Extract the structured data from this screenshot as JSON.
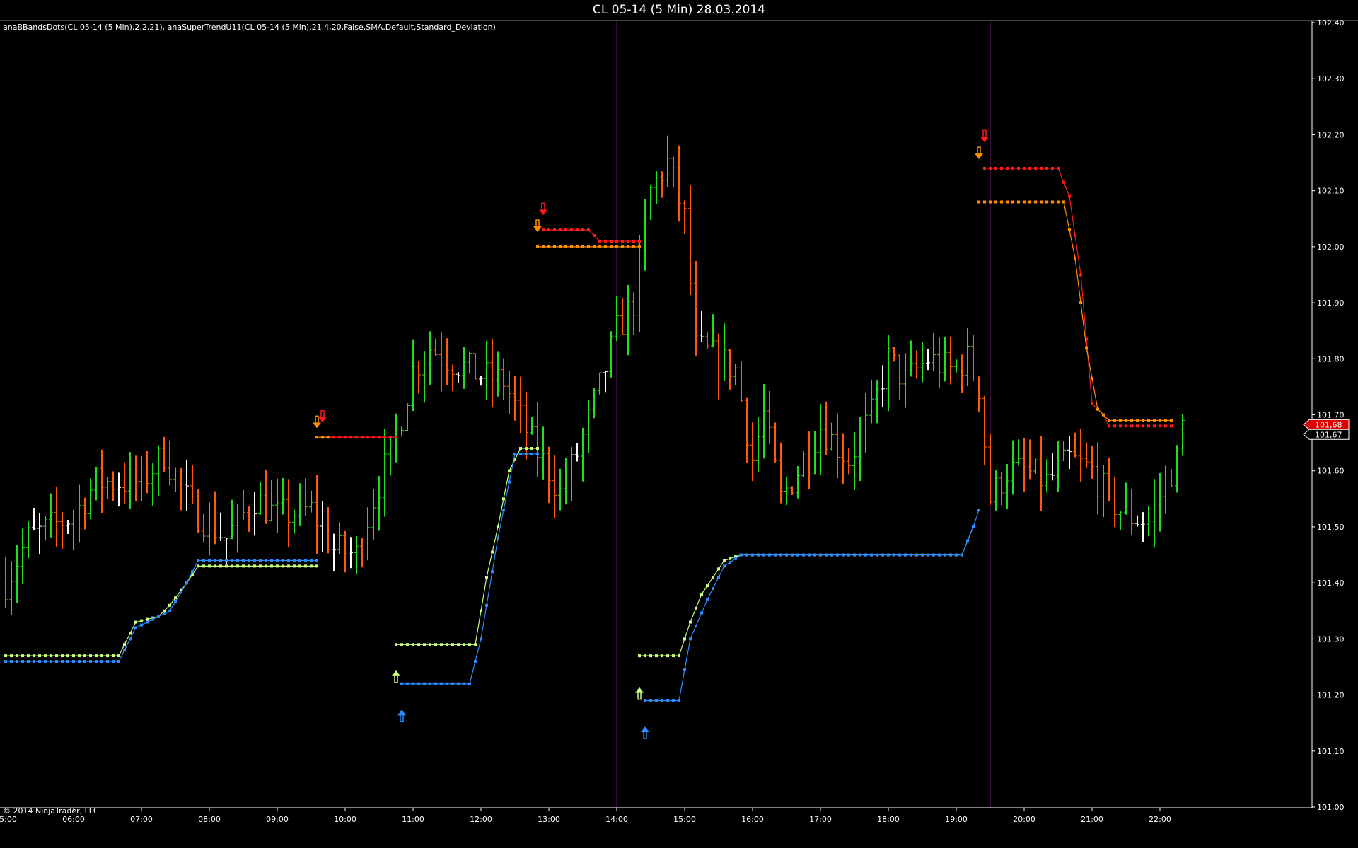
{
  "window": {
    "title": "CL 05-14 (5 Min)  28.03.2014"
  },
  "indicators_label": "anaBBandsDots(CL 05-14 (5 Min),2,2,21), anaSuperTrendU11(CL 05-14 (5 Min),21,4,20,False,SMA,Default,Standard_Deviation)",
  "copyright": "© 2014 NinjaTrader, LLC",
  "colors": {
    "background": "#000000",
    "up_bar": "#22dd22",
    "down_bar": "#ff5a0a",
    "neutral_bar": "#ffffff",
    "st_red": "#ff1a1a",
    "st_orange": "#ff8c00",
    "st_blue": "#2b8cff",
    "st_lightgreen": "#c8ff80",
    "session_line": "#6a1a6a",
    "axis": "#ffffff",
    "price_marker_red": "#dd0000"
  },
  "chart_data": {
    "type": "candlestick",
    "instrument": "CL 05-14",
    "interval": "5 Min",
    "date": "28.03.2014",
    "ylim": [
      101.0,
      102.4
    ],
    "y_ticks": [
      "102,40",
      "102,30",
      "102,20",
      "102,10",
      "102,00",
      "101,90",
      "101,80",
      "101,70",
      "101,60",
      "101,50",
      "101,40",
      "101,30",
      "101,20",
      "101,10",
      "101,00"
    ],
    "x_ticks": [
      "05:00",
      "06:00",
      "07:00",
      "08:00",
      "09:00",
      "10:00",
      "11:00",
      "12:00",
      "13:00",
      "14:00",
      "15:00",
      "16:00",
      "17:00",
      "18:00",
      "19:00",
      "20:00",
      "21:00",
      "22:00"
    ],
    "session_breaks": [
      "14:00",
      "19:30"
    ],
    "current_price_labels": [
      {
        "label": "101,68",
        "value": 101.68,
        "style": "red"
      },
      {
        "label": "101,67",
        "value": 101.67,
        "style": "white"
      }
    ],
    "price_anchors": [
      {
        "time": "05:00",
        "price": 101.4
      },
      {
        "time": "05:20",
        "price": 101.48
      },
      {
        "time": "06:00",
        "price": 101.52
      },
      {
        "time": "06:20",
        "price": 101.58
      },
      {
        "time": "07:00",
        "price": 101.58
      },
      {
        "time": "07:20",
        "price": 101.63
      },
      {
        "time": "07:45",
        "price": 101.53
      },
      {
        "time": "08:15",
        "price": 101.48
      },
      {
        "time": "08:40",
        "price": 101.55
      },
      {
        "time": "09:00",
        "price": 101.52
      },
      {
        "time": "09:30",
        "price": 101.53
      },
      {
        "time": "09:50",
        "price": 101.46
      },
      {
        "time": "10:10",
        "price": 101.45
      },
      {
        "time": "10:25",
        "price": 101.55
      },
      {
        "time": "10:45",
        "price": 101.66
      },
      {
        "time": "11:00",
        "price": 101.78
      },
      {
        "time": "11:15",
        "price": 101.82
      },
      {
        "time": "11:30",
        "price": 101.8
      },
      {
        "time": "12:00",
        "price": 101.77
      },
      {
        "time": "12:20",
        "price": 101.76
      },
      {
        "time": "12:45",
        "price": 101.65
      },
      {
        "time": "13:00",
        "price": 101.6
      },
      {
        "time": "13:10",
        "price": 101.56
      },
      {
        "time": "13:25",
        "price": 101.63
      },
      {
        "time": "13:45",
        "price": 101.75
      },
      {
        "time": "14:00",
        "price": 101.85
      },
      {
        "time": "14:15",
        "price": 101.9
      },
      {
        "time": "14:30",
        "price": 102.1
      },
      {
        "time": "14:45",
        "price": 102.15
      },
      {
        "time": "15:00",
        "price": 102.05
      },
      {
        "time": "15:10",
        "price": 101.82
      },
      {
        "time": "15:30",
        "price": 101.8
      },
      {
        "time": "15:45",
        "price": 101.78
      },
      {
        "time": "16:00",
        "price": 101.62
      },
      {
        "time": "16:10",
        "price": 101.7
      },
      {
        "time": "16:25",
        "price": 101.55
      },
      {
        "time": "16:40",
        "price": 101.6
      },
      {
        "time": "17:00",
        "price": 101.68
      },
      {
        "time": "17:25",
        "price": 101.62
      },
      {
        "time": "17:45",
        "price": 101.7
      },
      {
        "time": "18:00",
        "price": 101.8
      },
      {
        "time": "18:15",
        "price": 101.76
      },
      {
        "time": "18:35",
        "price": 101.8
      },
      {
        "time": "18:55",
        "price": 101.78
      },
      {
        "time": "19:10",
        "price": 101.8
      },
      {
        "time": "19:20",
        "price": 101.75
      },
      {
        "time": "19:30",
        "price": 101.55
      },
      {
        "time": "19:45",
        "price": 101.6
      },
      {
        "time": "20:00",
        "price": 101.6
      },
      {
        "time": "20:20",
        "price": 101.58
      },
      {
        "time": "20:40",
        "price": 101.62
      },
      {
        "time": "21:00",
        "price": 101.6
      },
      {
        "time": "21:15",
        "price": 101.55
      },
      {
        "time": "21:30",
        "price": 101.52
      },
      {
        "time": "21:50",
        "price": 101.51
      },
      {
        "time": "22:05",
        "price": 101.58
      },
      {
        "time": "22:15",
        "price": 101.62
      },
      {
        "time": "22:20",
        "price": 101.68
      }
    ],
    "supertrend_segments": [
      {
        "color": "st_lightgreen",
        "points": [
          [
            "05:00",
            101.27
          ],
          [
            "06:40",
            101.27
          ],
          [
            "06:45",
            101.29
          ],
          [
            "06:55",
            101.33
          ],
          [
            "07:15",
            101.34
          ],
          [
            "07:25",
            101.36
          ],
          [
            "07:40",
            101.4
          ],
          [
            "07:50",
            101.43
          ],
          [
            "09:35",
            101.43
          ]
        ]
      },
      {
        "color": "st_blue",
        "points": [
          [
            "05:00",
            101.26
          ],
          [
            "06:40",
            101.26
          ],
          [
            "06:45",
            101.28
          ],
          [
            "06:55",
            101.32
          ],
          [
            "07:15",
            101.34
          ],
          [
            "07:25",
            101.35
          ],
          [
            "07:40",
            101.4
          ],
          [
            "07:50",
            101.44
          ],
          [
            "09:35",
            101.44
          ]
        ]
      },
      {
        "color": "st_red",
        "points": [
          [
            "09:40",
            101.66
          ],
          [
            "10:45",
            101.66
          ]
        ]
      },
      {
        "color": "st_orange",
        "points": [
          [
            "09:35",
            101.66
          ],
          [
            "09:45",
            101.66
          ]
        ]
      },
      {
        "color": "st_lightgreen",
        "points": [
          [
            "10:45",
            101.29
          ],
          [
            "11:55",
            101.29
          ],
          [
            "12:05",
            101.41
          ],
          [
            "12:15",
            101.5
          ],
          [
            "12:25",
            101.6
          ],
          [
            "12:35",
            101.64
          ],
          [
            "12:50",
            101.64
          ]
        ]
      },
      {
        "color": "st_blue",
        "points": [
          [
            "10:50",
            101.22
          ],
          [
            "11:50",
            101.22
          ],
          [
            "12:00",
            101.3
          ],
          [
            "12:15",
            101.48
          ],
          [
            "12:30",
            101.63
          ],
          [
            "12:50",
            101.63
          ]
        ]
      },
      {
        "color": "st_red",
        "points": [
          [
            "12:55",
            102.03
          ],
          [
            "13:35",
            102.03
          ],
          [
            "13:45",
            102.01
          ],
          [
            "14:20",
            102.01
          ]
        ]
      },
      {
        "color": "st_orange",
        "points": [
          [
            "12:50",
            102.0
          ],
          [
            "14:20",
            102.0
          ]
        ]
      },
      {
        "color": "st_lightgreen",
        "points": [
          [
            "14:20",
            101.27
          ],
          [
            "14:55",
            101.27
          ],
          [
            "15:05",
            101.33
          ],
          [
            "15:15",
            101.38
          ],
          [
            "15:35",
            101.44
          ],
          [
            "15:50",
            101.45
          ],
          [
            "19:05",
            101.45
          ],
          [
            "19:15",
            101.5
          ]
        ]
      },
      {
        "color": "st_blue",
        "points": [
          [
            "14:25",
            101.19
          ],
          [
            "14:55",
            101.19
          ],
          [
            "15:05",
            101.3
          ],
          [
            "15:20",
            101.37
          ],
          [
            "15:35",
            101.43
          ],
          [
            "15:50",
            101.45
          ],
          [
            "19:05",
            101.45
          ],
          [
            "19:15",
            101.5
          ],
          [
            "19:20",
            101.53
          ]
        ]
      },
      {
        "color": "st_red",
        "points": [
          [
            "19:25",
            102.14
          ],
          [
            "20:30",
            102.14
          ],
          [
            "20:40",
            102.09
          ],
          [
            "20:50",
            101.95
          ],
          [
            "21:00",
            101.72
          ],
          [
            "21:10",
            101.7
          ],
          [
            "21:15",
            101.68
          ],
          [
            "22:10",
            101.68
          ]
        ]
      },
      {
        "color": "st_orange",
        "points": [
          [
            "19:20",
            102.08
          ],
          [
            "20:35",
            102.08
          ],
          [
            "20:45",
            101.98
          ],
          [
            "20:55",
            101.82
          ],
          [
            "21:05",
            101.71
          ],
          [
            "21:15",
            101.69
          ],
          [
            "22:10",
            101.69
          ]
        ]
      }
    ],
    "arrows": [
      {
        "time": "09:35",
        "price": 101.68,
        "dir": "down",
        "color": "st_orange"
      },
      {
        "time": "09:40",
        "price": 101.69,
        "dir": "down",
        "color": "st_red"
      },
      {
        "time": "10:45",
        "price": 101.24,
        "dir": "up",
        "color": "st_lightgreen"
      },
      {
        "time": "10:50",
        "price": 101.17,
        "dir": "up",
        "color": "st_blue"
      },
      {
        "time": "12:50",
        "price": 102.03,
        "dir": "down",
        "color": "st_orange"
      },
      {
        "time": "12:55",
        "price": 102.06,
        "dir": "down",
        "color": "st_red"
      },
      {
        "time": "14:20",
        "price": 101.21,
        "dir": "up",
        "color": "st_lightgreen"
      },
      {
        "time": "14:25",
        "price": 101.14,
        "dir": "up",
        "color": "st_blue"
      },
      {
        "time": "19:20",
        "price": 102.16,
        "dir": "down",
        "color": "st_orange"
      },
      {
        "time": "19:25",
        "price": 102.19,
        "dir": "down",
        "color": "st_red"
      }
    ]
  }
}
